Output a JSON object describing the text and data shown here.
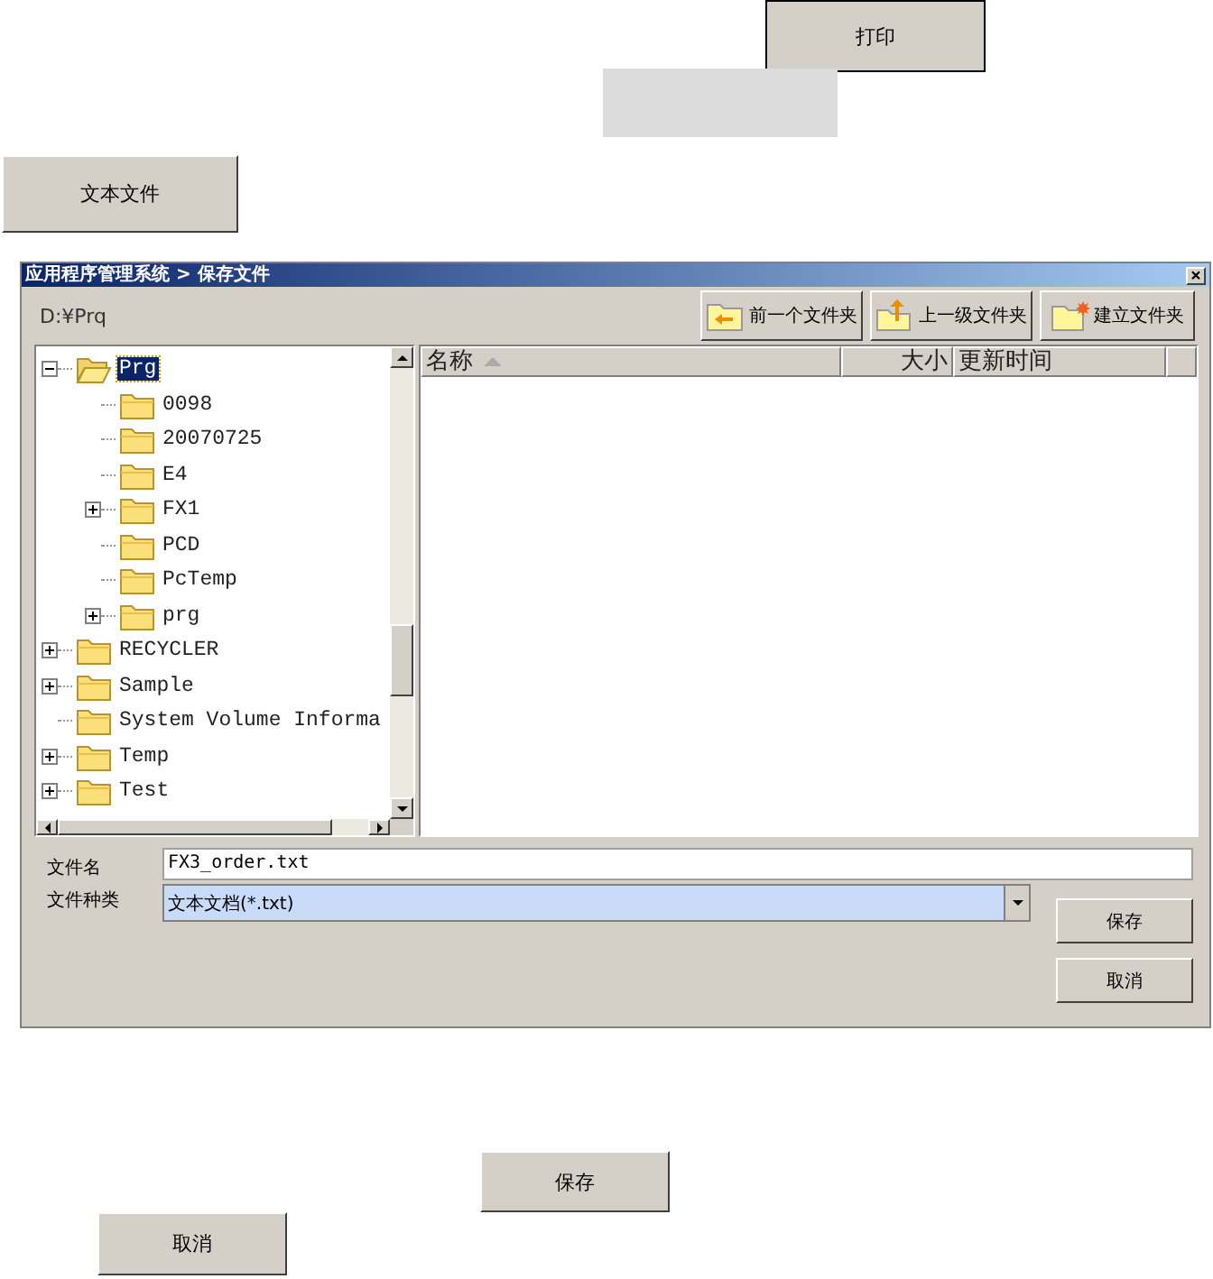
{
  "print_button": "打印",
  "text_file_button": "文本文件",
  "dialog": {
    "title": "应用程序管理系统 > 保存文件",
    "path": "D:¥Prq",
    "toolbar": [
      {
        "kind": "back",
        "label": "前一个文件夹"
      },
      {
        "kind": "up",
        "label": "上一级文件夹"
      },
      {
        "kind": "new",
        "label": "建立文件夹"
      }
    ],
    "tree": [
      {
        "label": "Prg",
        "selected": true,
        "has_children": true,
        "expanded": true,
        "children": [
          {
            "label": "0098",
            "selected": false,
            "has_children": false,
            "expanded": false
          },
          {
            "label": "20070725",
            "selected": false,
            "has_children": false,
            "expanded": false
          },
          {
            "label": "E4",
            "selected": false,
            "has_children": false,
            "expanded": false
          },
          {
            "label": "FX1",
            "selected": false,
            "has_children": true,
            "expanded": false
          },
          {
            "label": "PCD",
            "selected": false,
            "has_children": false,
            "expanded": false
          },
          {
            "label": "PcTemp",
            "selected": false,
            "has_children": false,
            "expanded": false
          },
          {
            "label": "prg",
            "selected": false,
            "has_children": true,
            "expanded": false
          }
        ]
      },
      {
        "label": "RECYCLER",
        "selected": false,
        "has_children": true,
        "expanded": false
      },
      {
        "label": "Sample",
        "selected": false,
        "has_children": true,
        "expanded": false
      },
      {
        "label": "System Volume Informa",
        "selected": false,
        "has_children": false,
        "expanded": false
      },
      {
        "label": "Temp",
        "selected": false,
        "has_children": true,
        "expanded": false
      },
      {
        "label": "Test",
        "selected": false,
        "has_children": true,
        "expanded": false
      }
    ],
    "columns": [
      {
        "label": "名称",
        "sorted": true
      },
      {
        "label": "大小",
        "sorted": false
      },
      {
        "label": "更新时间",
        "sorted": false
      }
    ],
    "filename": {
      "label": "文件名",
      "value": "FX3_order.txt"
    },
    "filetype": {
      "label": "文件种类",
      "value": "文本文档(*.txt)"
    },
    "buttons": [
      "保存",
      "取消"
    ]
  },
  "bottom_buttons": [
    "保存",
    "取消"
  ]
}
